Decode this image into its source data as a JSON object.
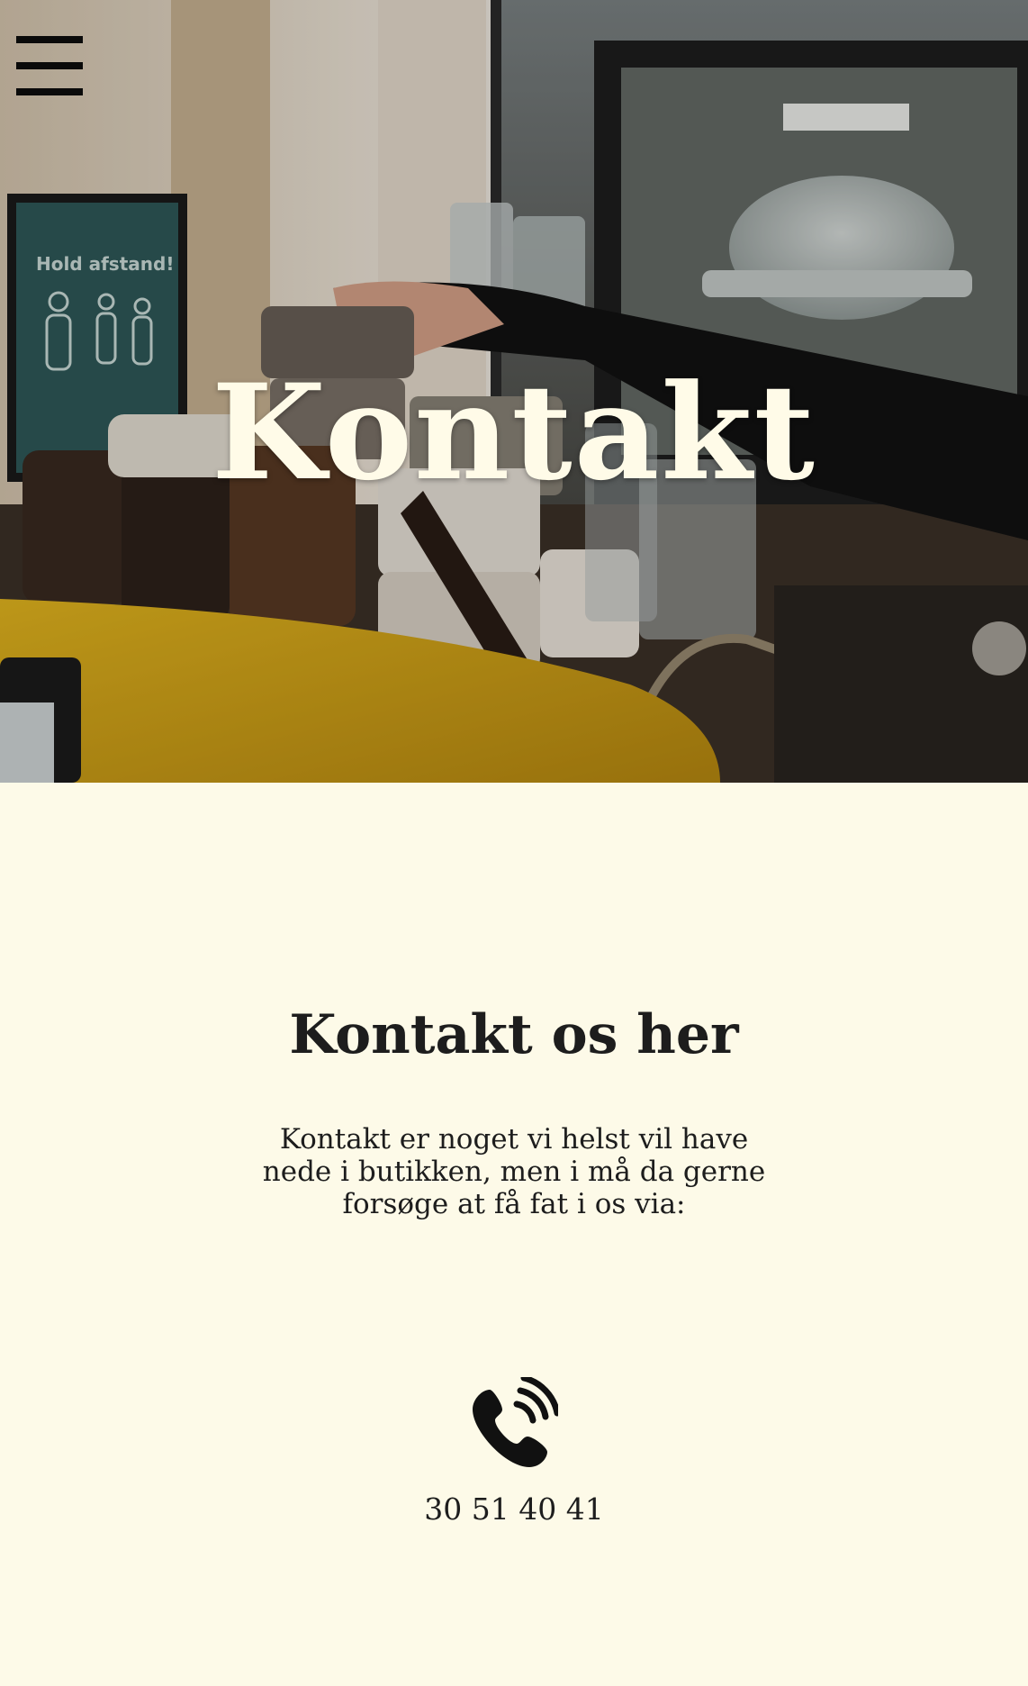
{
  "hero": {
    "title": "Kontakt",
    "poster_text": "Hold afstand!"
  },
  "menu": {
    "icon": "hamburger-menu-icon"
  },
  "contact": {
    "heading": "Kontakt os her",
    "intro": "Kontakt er noget vi helst vil have nede i butikken, men i må da gerne forsøge at få fat i os via:",
    "phone_icon": "phone-ringing-icon",
    "phone_number": "30 51 40 41"
  },
  "colors": {
    "background": "#fdfae8",
    "text": "#1d1d1d",
    "hero_title": "#fffbe8",
    "espresso_machine": "#e0b320"
  }
}
